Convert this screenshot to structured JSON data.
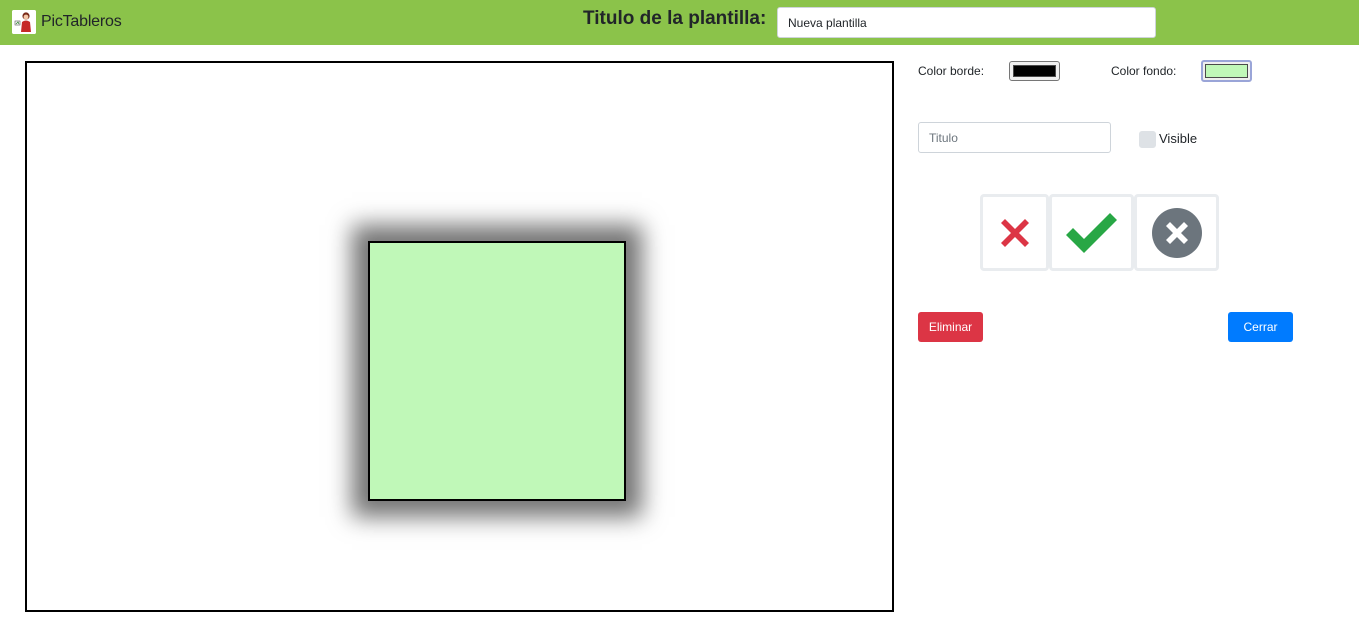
{
  "app": {
    "name": "PicTableros"
  },
  "header": {
    "template_title_label": "Titulo de la plantilla:",
    "template_title_value": "Nueva plantilla"
  },
  "panel": {
    "border_color_label": "Color borde:",
    "border_color_value": "#000000",
    "background_color_label": "Color fondo:",
    "background_color_value": "#c0f8b8",
    "title_placeholder": "Titulo",
    "title_value": "",
    "visible_label": "Visible",
    "visible_checked": false,
    "icons": [
      "x-mark-icon",
      "check-mark-icon",
      "circle-x-icon"
    ],
    "delete_label": "Eliminar",
    "close_label": "Cerrar"
  },
  "colors": {
    "navbar": "#8bc34a",
    "danger": "#dc3545",
    "primary": "#007bff",
    "success": "#28a745",
    "secondary": "#6c757d",
    "shape_fill": "#c0f8b8",
    "shape_border": "#000000"
  }
}
